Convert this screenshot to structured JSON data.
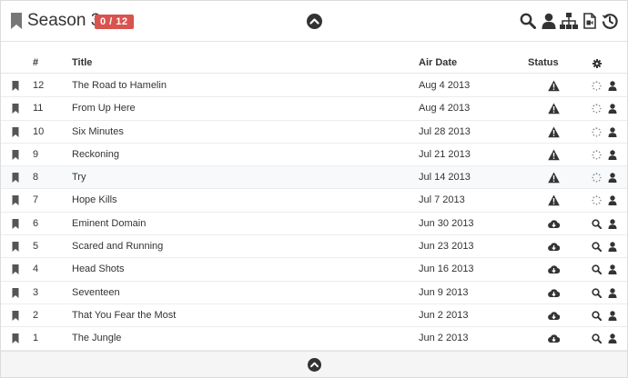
{
  "header": {
    "title": "Season 3",
    "badge": "0 / 12",
    "tools": [
      "search-icon",
      "user-icon",
      "sitemap-icon",
      "file-video-icon",
      "history-icon"
    ]
  },
  "table": {
    "columns": {
      "number": "#",
      "title": "Title",
      "air_date": "Air Date",
      "status": "Status"
    },
    "rows": [
      {
        "number": "12",
        "title": "The Road to Hamelin",
        "air_date": "Aug 4 2013",
        "status": "warning",
        "action": "loading"
      },
      {
        "number": "11",
        "title": "From Up Here",
        "air_date": "Aug 4 2013",
        "status": "warning",
        "action": "loading"
      },
      {
        "number": "10",
        "title": "Six Minutes",
        "air_date": "Jul 28 2013",
        "status": "warning",
        "action": "loading"
      },
      {
        "number": "9",
        "title": "Reckoning",
        "air_date": "Jul 21 2013",
        "status": "warning",
        "action": "loading"
      },
      {
        "number": "8",
        "title": "Try",
        "air_date": "Jul 14 2013",
        "status": "warning",
        "action": "loading"
      },
      {
        "number": "7",
        "title": "Hope Kills",
        "air_date": "Jul 7 2013",
        "status": "warning",
        "action": "loading"
      },
      {
        "number": "6",
        "title": "Eminent Domain",
        "air_date": "Jun 30 2013",
        "status": "download",
        "action": "search"
      },
      {
        "number": "5",
        "title": "Scared and Running",
        "air_date": "Jun 23 2013",
        "status": "download",
        "action": "search"
      },
      {
        "number": "4",
        "title": "Head Shots",
        "air_date": "Jun 16 2013",
        "status": "download",
        "action": "search"
      },
      {
        "number": "3",
        "title": "Seventeen",
        "air_date": "Jun 9 2013",
        "status": "download",
        "action": "search"
      },
      {
        "number": "2",
        "title": "That You Fear the Most",
        "air_date": "Jun 2 2013",
        "status": "download",
        "action": "search"
      },
      {
        "number": "1",
        "title": "The Jungle",
        "air_date": "Jun 2 2013",
        "status": "download",
        "action": "search"
      }
    ]
  },
  "colors": {
    "badge": "#d9534f",
    "icon": "#333333",
    "muted_icon": "#888888"
  }
}
